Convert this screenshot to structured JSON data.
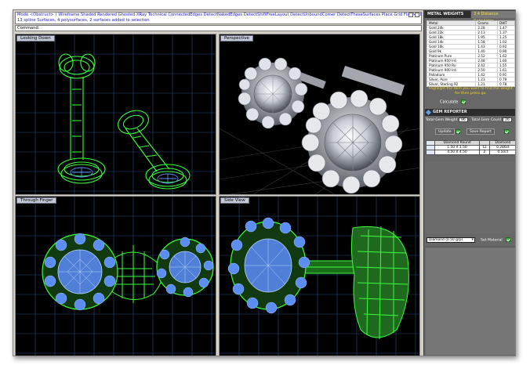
{
  "command": {
    "history": "Mode <Obstruct> ( Wireframe  Shaded  Rendered  Ghosted  XRay  Technical  ConnectedEdges  DetectNakedEdges  DetectShiftFreeLayout  DetectUnboundCorner  DetectTheseSurfaces  Place Grid  Flat Mode  Plastic  Presentation  Bo",
    "history_line2": "13 spline Surfaces, 4 polysurfaces, 2 surfaces added to selection",
    "prompt": "Command:"
  },
  "viewports": {
    "top": "Looking Down",
    "perspective": "Perspective",
    "front": "Through Finger",
    "right": "Side View"
  },
  "metal_weights": {
    "tab_label": "METAL WEIGHTS",
    "tab2_label": "3 4 Distance Calculator",
    "columns": [
      "Metal",
      "Grams",
      "DWT"
    ],
    "rows": [
      [
        "Gold 24k",
        "2.28",
        "1.47"
      ],
      [
        "Gold 22k",
        "2.13",
        "1.37"
      ],
      [
        "Gold 18k",
        "1.95",
        "1.25"
      ],
      [
        "Gold 14k",
        "1.58",
        "1.02"
      ],
      [
        "Gold 10k",
        "1.43",
        "0.92"
      ],
      [
        "Gold 9k",
        "1.40",
        "0.90"
      ],
      [
        "Platinum Pure",
        "2.52",
        "1.62"
      ],
      [
        "Platinum 950 Ird",
        "2.48",
        "1.60"
      ],
      [
        "Platinum 950 Ru",
        "2.42",
        "1.55"
      ],
      [
        "Platinum 900 Ird",
        "2.50",
        "1.61"
      ],
      [
        "Palladium",
        "1.42",
        "0.91"
      ],
      [
        "Silver, Pure",
        "1.23",
        "0.79"
      ],
      [
        "Silver, Sterling 92",
        "1.21",
        "0.78"
      ]
    ],
    "hint": "Highlight the item you want to find the weight for then press go.",
    "calculate_label": "Calculate"
  },
  "gem_reporter": {
    "title": "GEM REPORTER",
    "total_weight_label": "Total Gem Weight",
    "total_weight_value": "96",
    "total_count_label": "Total Gem Count",
    "total_count_value": "26",
    "update_label": "Update",
    "save_label": "Save Report",
    "columns": [
      "",
      "Diamond Round",
      "",
      "Diamond"
    ],
    "rows": [
      [
        "",
        "1.50 X 1.50",
        "12",
        "0.286ct"
      ],
      [
        "",
        "4.50 X 4.50",
        "2",
        "0.50ct"
      ]
    ],
    "selected_gem": "Diamond   (0.50 grp)",
    "set_material_label": "Set Material"
  },
  "colors": {
    "wire_green": "#3cff3c",
    "gem_blue": "#5b8ef0",
    "grid": "#2a4a7a",
    "panel_bg": "#686868",
    "hint_yellow": "#f5d322"
  }
}
